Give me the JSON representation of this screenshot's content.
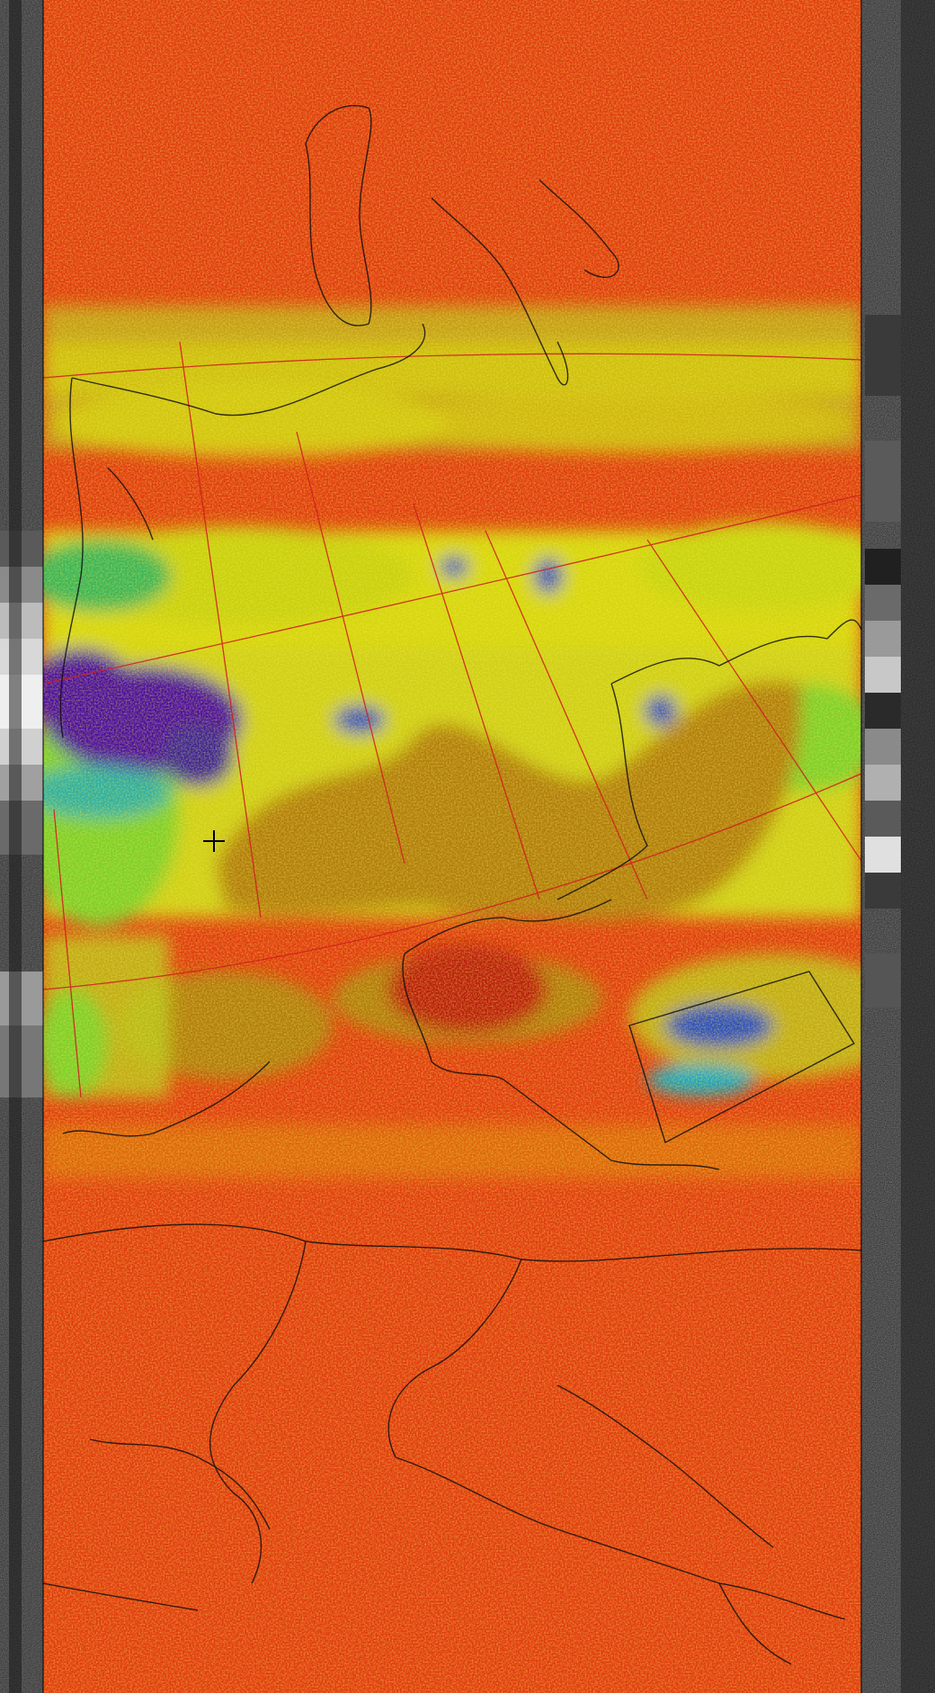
{
  "image": {
    "kind": "false-color satellite weather image",
    "labels": []
  },
  "palette": {
    "red": "#e03a10",
    "dark_red": "#b81e08",
    "orange_red": "#f04a10",
    "yellow": "#d6d60a",
    "olive": "#b07c08",
    "green": "#7ccf2a",
    "cyan": "#18a6c4",
    "blue": "#2a4ec0",
    "purple": "#4a10a0",
    "grid_line": "#d02020",
    "border_line": "#1a1a1a",
    "telemetry_dark": "#1a1a1a",
    "telemetry_light": "#e8e8e8"
  },
  "marker": {
    "icon": "crosshair-icon"
  }
}
